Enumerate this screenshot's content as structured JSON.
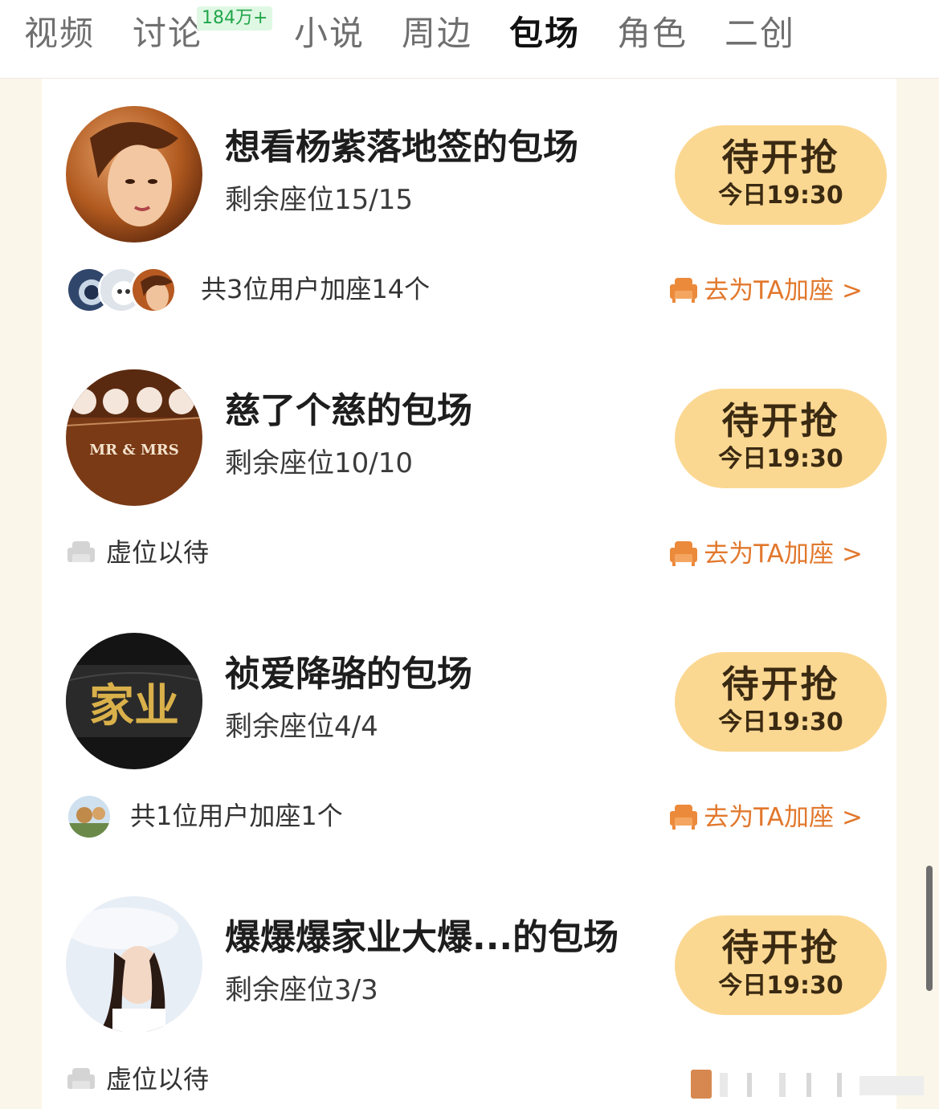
{
  "tabs": [
    {
      "label": "视频",
      "active": false
    },
    {
      "label": "讨论",
      "active": false,
      "badge": "184万+"
    },
    {
      "label": "小说",
      "active": false
    },
    {
      "label": "周边",
      "active": false
    },
    {
      "label": "包场",
      "active": true
    },
    {
      "label": "角色",
      "active": false
    },
    {
      "label": "二创",
      "active": false
    }
  ],
  "items": [
    {
      "title": "想看杨紫落地签的包场",
      "seats": "剩余座位15/15",
      "button_main": "待开抢",
      "button_time": "今日19:30",
      "footer_text": "共3位用户加座14个",
      "add_link": "去为TA加座",
      "chevron": ">"
    },
    {
      "title": "慈了个慈的包场",
      "seats": "剩余座位10/10",
      "button_main": "待开抢",
      "button_time": "今日19:30",
      "footer_text": "虚位以待",
      "add_link": "去为TA加座",
      "chevron": ">",
      "avatar_text": "MR & MRS"
    },
    {
      "title": "祯爱降骆的包场",
      "seats": "剩余座位4/4",
      "button_main": "待开抢",
      "button_time": "今日19:30",
      "footer_text": "共1位用户加座1个",
      "add_link": "去为TA加座",
      "chevron": ">",
      "avatar_text": "家业"
    },
    {
      "title": "爆爆爆家业大爆...的包场",
      "seats": "剩余座位3/3",
      "button_main": "待开抢",
      "button_time": "今日19:30",
      "footer_text": "虚位以待"
    }
  ],
  "colors": {
    "accent_button": "#fbd892",
    "link_orange": "#e2782d",
    "badge_green": "#22a64a",
    "page_bg": "#fbf6ea"
  },
  "icons": [
    "sofa-icon",
    "chevron-right-icon"
  ]
}
